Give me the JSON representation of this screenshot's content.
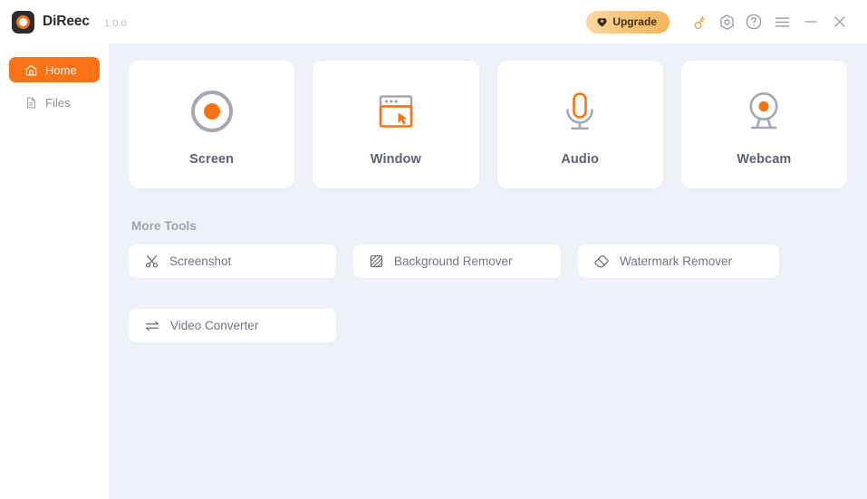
{
  "app": {
    "name": "DiReec",
    "version": "1.0.0",
    "logo_icon": "record-dot-logo-icon"
  },
  "titlebar": {
    "upgrade": {
      "label": "Upgrade",
      "icon": "heart-badge-icon",
      "gradient_from": "#fbd9a5",
      "gradient_to": "#f6b45e",
      "text_color": "#3f2d17"
    },
    "actions": [
      {
        "name": "activate-key-icon",
        "tooltip": "Key",
        "color": "#f0a548"
      },
      {
        "name": "settings-hex-icon",
        "tooltip": "Settings",
        "color": "#8d929c"
      },
      {
        "name": "help-question-icon",
        "tooltip": "Help",
        "color": "#8d929c"
      }
    ],
    "window_controls": [
      {
        "name": "menu-hamburger-icon",
        "label": "Menu"
      },
      {
        "name": "minimize-icon",
        "label": "Minimize"
      },
      {
        "name": "close-icon",
        "label": "Close"
      }
    ]
  },
  "sidebar": {
    "items": [
      {
        "label": "Home",
        "icon": "home-icon",
        "active": true
      },
      {
        "label": "Files",
        "icon": "file-document-icon",
        "active": false
      }
    ],
    "active_bg": "#f97316"
  },
  "main": {
    "modes": [
      {
        "label": "Screen",
        "icon": "record-circle-icon"
      },
      {
        "label": "Window",
        "icon": "window-cursor-icon"
      },
      {
        "label": "Audio",
        "icon": "microphone-icon"
      },
      {
        "label": "Webcam",
        "icon": "webcam-icon"
      }
    ],
    "more_tools_title": "More Tools",
    "tools": [
      {
        "label": "Screenshot",
        "icon": "scissors-icon"
      },
      {
        "label": "Background Remover",
        "icon": "hatched-square-icon"
      },
      {
        "label": "Watermark Remover",
        "icon": "eraser-icon"
      },
      {
        "label": "Video Converter",
        "icon": "swap-arrows-icon"
      }
    ]
  },
  "theme": {
    "accent": "#f97316",
    "content_bg": "#eef1f7",
    "card_bg": "#ffffff",
    "icon_gray": "#9aa0ab",
    "text_gray": "#6f7581"
  }
}
